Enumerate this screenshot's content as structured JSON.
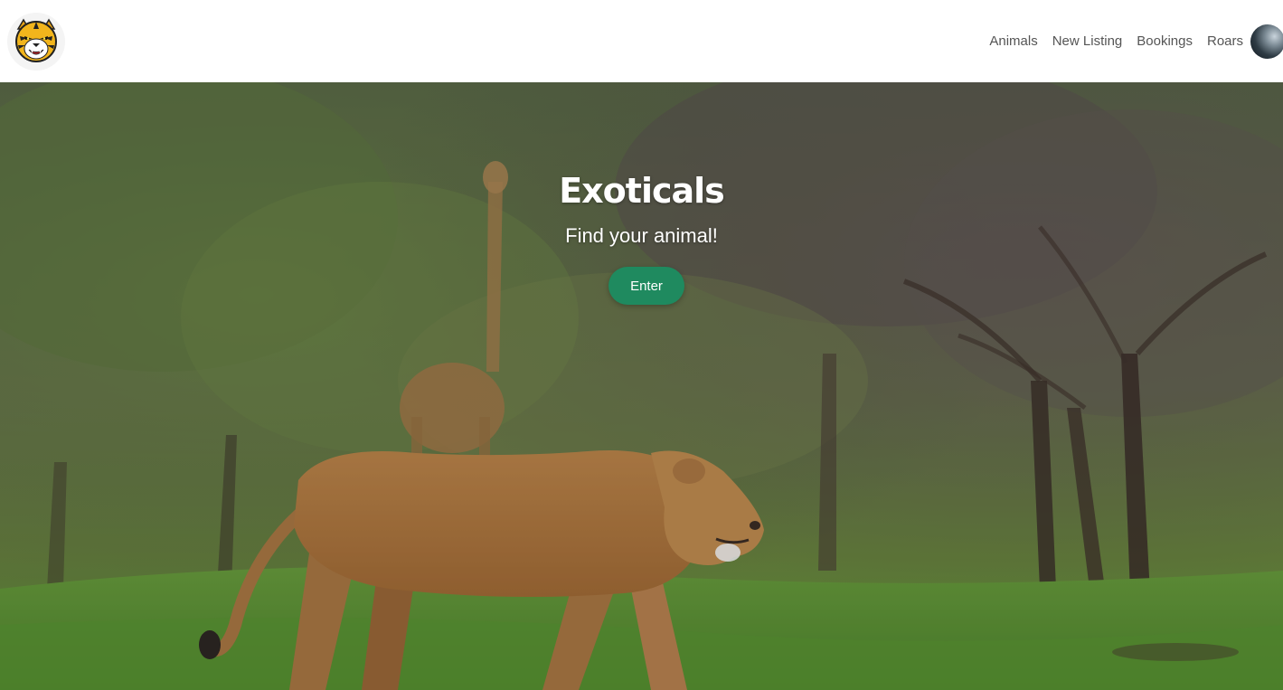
{
  "navbar": {
    "logo_icon": "tiger-logo-icon",
    "links": [
      {
        "label": "Animals"
      },
      {
        "label": "New Listing"
      },
      {
        "label": "Bookings"
      },
      {
        "label": "Roars"
      }
    ],
    "avatar_icon": "user-avatar"
  },
  "hero": {
    "title": "Exoticals",
    "subtitle": "Find your animal!",
    "cta_label": "Enter",
    "background": "lioness-and-giraffe-savanna-photo"
  },
  "colors": {
    "accent": "#1f8a5f",
    "nav_text": "#555555",
    "hero_text": "#ffffff"
  }
}
